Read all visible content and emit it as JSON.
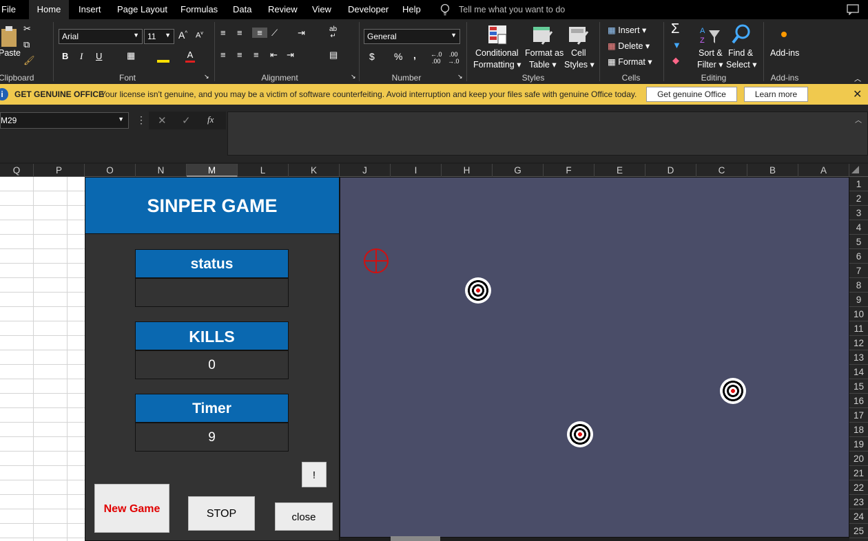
{
  "menu": {
    "tabs": [
      "File",
      "Home",
      "Insert",
      "Page Layout",
      "Formulas",
      "Data",
      "Review",
      "View",
      "Developer",
      "Help"
    ],
    "active": "Home",
    "tell_me": "Tell me what you want to do"
  },
  "ribbon": {
    "clipboard": {
      "paste": "Paste",
      "label": "Clipboard"
    },
    "font": {
      "name": "Arial",
      "size": "11",
      "label": "Font",
      "bold": "B",
      "italic": "I",
      "underline": "U"
    },
    "alignment": {
      "label": "Alignment"
    },
    "number": {
      "format": "General",
      "label": "Number",
      "currency": "$",
      "percent": "%",
      "comma": ","
    },
    "styles": {
      "conditional": "Conditional\nFormatting",
      "conditional_1": "Conditional",
      "conditional_2": "Formatting",
      "format_table_1": "Format as",
      "format_table_2": "Table",
      "cell_styles_1": "Cell",
      "cell_styles_2": "Styles",
      "label": "Styles"
    },
    "cells": {
      "insert": "Insert",
      "delete": "Delete",
      "format": "Format",
      "label": "Cells"
    },
    "editing": {
      "sort_1": "Sort &",
      "sort_2": "Filter",
      "find_1": "Find &",
      "find_2": "Select",
      "label": "Editing"
    },
    "addins": {
      "addins": "Add-ins",
      "label": "Add-ins"
    }
  },
  "message_bar": {
    "title": "GET GENUINE OFFICE",
    "text": "Your license isn't genuine, and you may be a victim of software counterfeiting. Avoid interruption and keep your files safe with genuine Office today.",
    "button1": "Get genuine Office",
    "button2": "Learn more"
  },
  "formula_bar": {
    "name_box": "M29",
    "fx": "fx",
    "value": ""
  },
  "columns": [
    "Q",
    "P",
    "O",
    "N",
    "M",
    "L",
    "K",
    "J",
    "I",
    "H",
    "G",
    "F",
    "E",
    "D",
    "C",
    "B",
    "A"
  ],
  "rows": [
    "1",
    "2",
    "3",
    "4",
    "5",
    "6",
    "7",
    "8",
    "9",
    "10",
    "11",
    "12",
    "13",
    "14",
    "15",
    "16",
    "17",
    "18",
    "19",
    "20",
    "21",
    "22",
    "23",
    "24",
    "25"
  ],
  "game": {
    "title": "SINPER GAME",
    "status_label": "status",
    "status_value": "",
    "kills_label": "KILLS",
    "kills_value": "0",
    "timer_label": "Timer",
    "timer_value": "9",
    "info_button": "!",
    "new_game": "New Game",
    "stop": "STOP",
    "close": "close"
  },
  "colors": {
    "accent": "#0a68b0",
    "game_bg": "#4a4d68",
    "message_bar": "#f0c94e",
    "new_game_text": "#e00000"
  }
}
